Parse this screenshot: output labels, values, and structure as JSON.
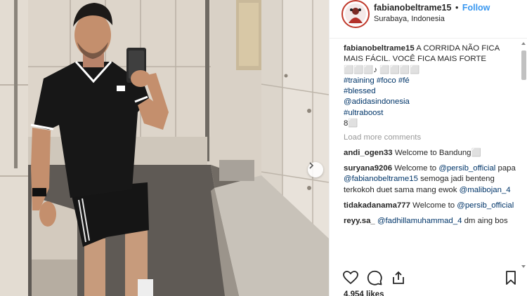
{
  "post": {
    "username": "fabianobeltrame15",
    "separator": "•",
    "follow_label": "Follow",
    "location": "Surabaya, Indonesia"
  },
  "caption": {
    "username": "fabianobeltrame15",
    "text": "A CORRIDA NÃO FICA MAIS FÁCIL. VOCÊ FICA MAIS FORTE ⬜⬜⬜♪ ⬜⬜⬜⬜",
    "tags": [
      "#training",
      "#foco",
      "#fé",
      "#blessed"
    ],
    "mention": "@adidasindonesia",
    "tag_ultraboost": "#ultraboost",
    "end_text": "8⬜"
  },
  "load_more_label": "Load more comments",
  "comments": [
    {
      "user": "andi_ogen33",
      "text": "Welcome to Bandung⬜"
    },
    {
      "user": "suryana9206",
      "text_1": "Welcome to",
      "mention_1": "@persib_official",
      "text_2": "papa",
      "mention_2": "@fabianobeltrame15",
      "text_3": "semoga jadi benteng terkokoh duet sama mang ewok",
      "mention_3": "@malibojan_4"
    },
    {
      "user": "tidakadanama777",
      "text": "Welcome to",
      "mention": "@persib_official"
    },
    {
      "user": "reyy.sa_",
      "mention": "@fadhillamuhammad_4",
      "text": "dm aing bos"
    }
  ],
  "actions": {
    "like_icon": "heart-icon",
    "comment_icon": "comment-icon",
    "share_icon": "share-icon",
    "save_icon": "bookmark-icon"
  },
  "likes_label": "4,954 likes",
  "colors": {
    "link": "#003569",
    "follow": "#3897f0",
    "muted": "#999999",
    "avatar_ring": "#c0392b"
  }
}
